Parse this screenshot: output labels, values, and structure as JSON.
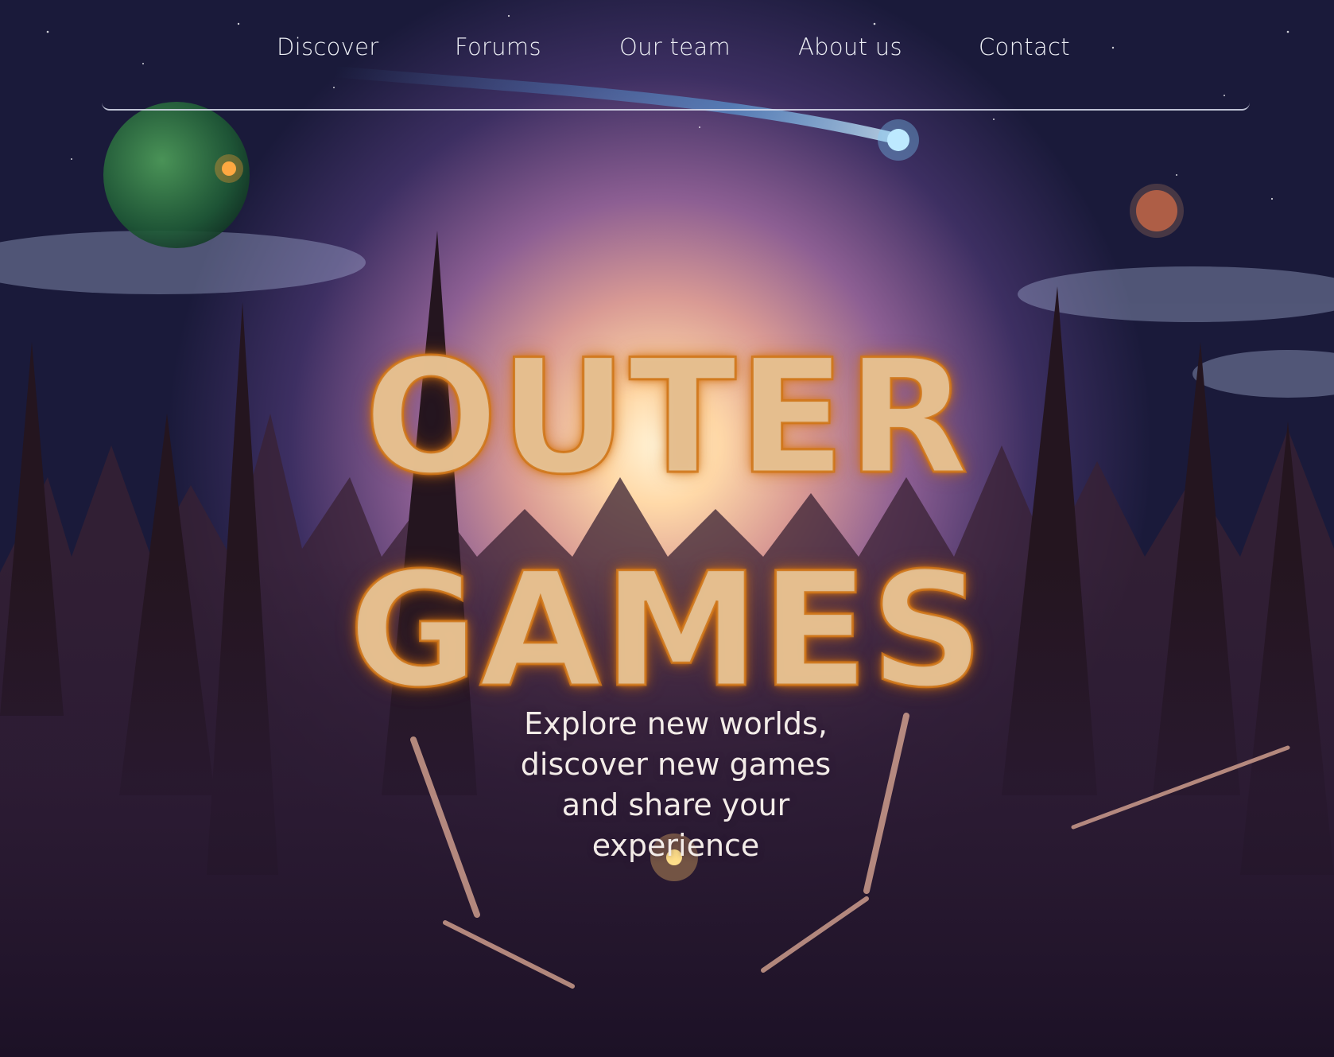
{
  "nav": {
    "items": [
      {
        "label": "Discover"
      },
      {
        "label": "Forums"
      },
      {
        "label": "Our team"
      },
      {
        "label": "About us"
      },
      {
        "label": "Contact"
      }
    ]
  },
  "hero": {
    "title_line1": "OUTER",
    "title_line2": "GAMES",
    "tagline": "Explore new worlds, discover new games and share your experience"
  },
  "colors": {
    "title_fill": "#e8ceaa",
    "title_glow": "#d67614",
    "nav_text": "#eef0f6",
    "sky_dark": "#1a1a3a",
    "sunlight": "#ffe6b8"
  }
}
